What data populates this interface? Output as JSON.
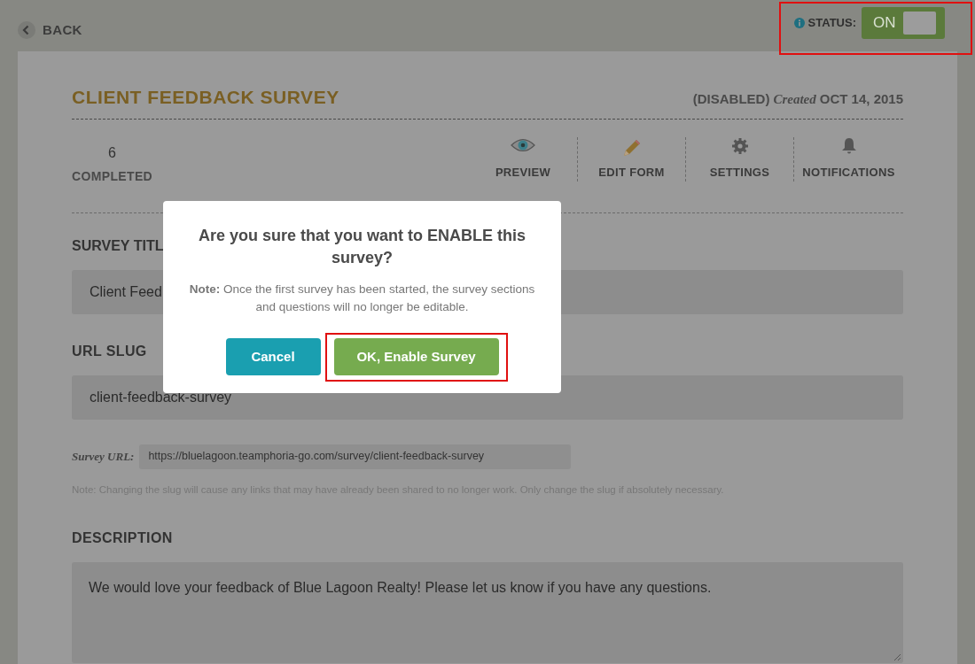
{
  "header": {
    "back": "BACK",
    "status_label": "STATUS:",
    "status_toggle": {
      "label": "ON",
      "on": true,
      "highlighted": true
    }
  },
  "survey": {
    "title": "CLIENT FEEDBACK SURVEY",
    "state": "(DISABLED)",
    "created_label": "Created",
    "created_date": "OCT 14, 2015"
  },
  "stats": {
    "count": "6",
    "label": "COMPLETED"
  },
  "actions": [
    {
      "kind": "preview",
      "label": "PREVIEW"
    },
    {
      "kind": "edit",
      "label": "EDIT FORM"
    },
    {
      "kind": "settings",
      "label": "SETTINGS"
    },
    {
      "kind": "notifications",
      "label": "NOTIFICATIONS"
    }
  ],
  "form": {
    "title_label": "SURVEY TITL",
    "title_value": "Client Feed",
    "slug_label": "URL SLUG",
    "slug_value": "client-feedback-survey",
    "url_label": "Survey URL:",
    "url_value": "https://bluelagoon.teamphoria-go.com/survey/client-feedback-survey",
    "note": "Note: Changing the slug will cause any links that may have already been shared to no longer work. Only change the slug if absolutely necessary.",
    "description_label": "DESCRIPTION",
    "description_value": "We would love your feedback of Blue Lagoon Realty! Please let us know if you have any questions."
  },
  "dialog": {
    "heading": "Are you sure that you want to ENABLE this survey?",
    "note": "**Note:** Once the first survey has been started, the survey sections and questions will no longer be editable.",
    "buttons": [
      {
        "kind": "cancel",
        "label": "Cancel"
      },
      {
        "kind": "confirm",
        "label": "OK, Enable Survey",
        "highlighted": true
      }
    ]
  }
}
